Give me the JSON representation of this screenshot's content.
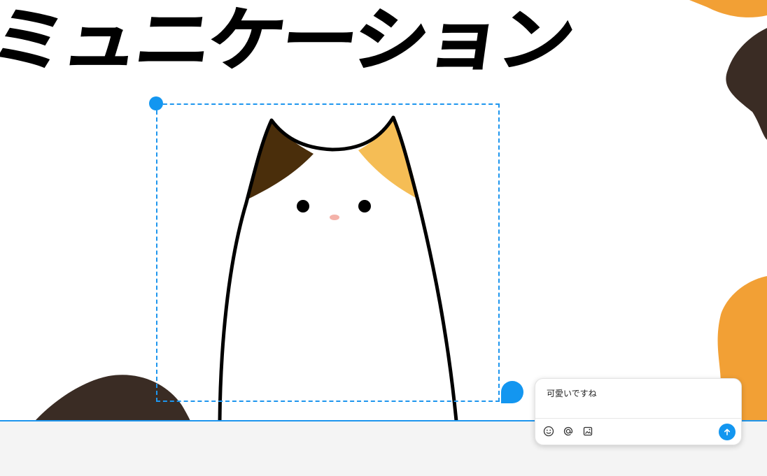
{
  "canvas": {
    "headline": "ミュニケーション"
  },
  "comment": {
    "text": "可愛いですね",
    "tools": [
      "emoji-icon",
      "mention-icon",
      "image-icon"
    ],
    "send_icon": "arrow-up-icon"
  },
  "colors": {
    "selection": "#1e96ee",
    "accent": "#1396f0",
    "orange": "#f2a035",
    "dark_brown": "#3a2c24",
    "ear_brown": "#4a2e0b",
    "ear_orange": "#f5bd55"
  }
}
